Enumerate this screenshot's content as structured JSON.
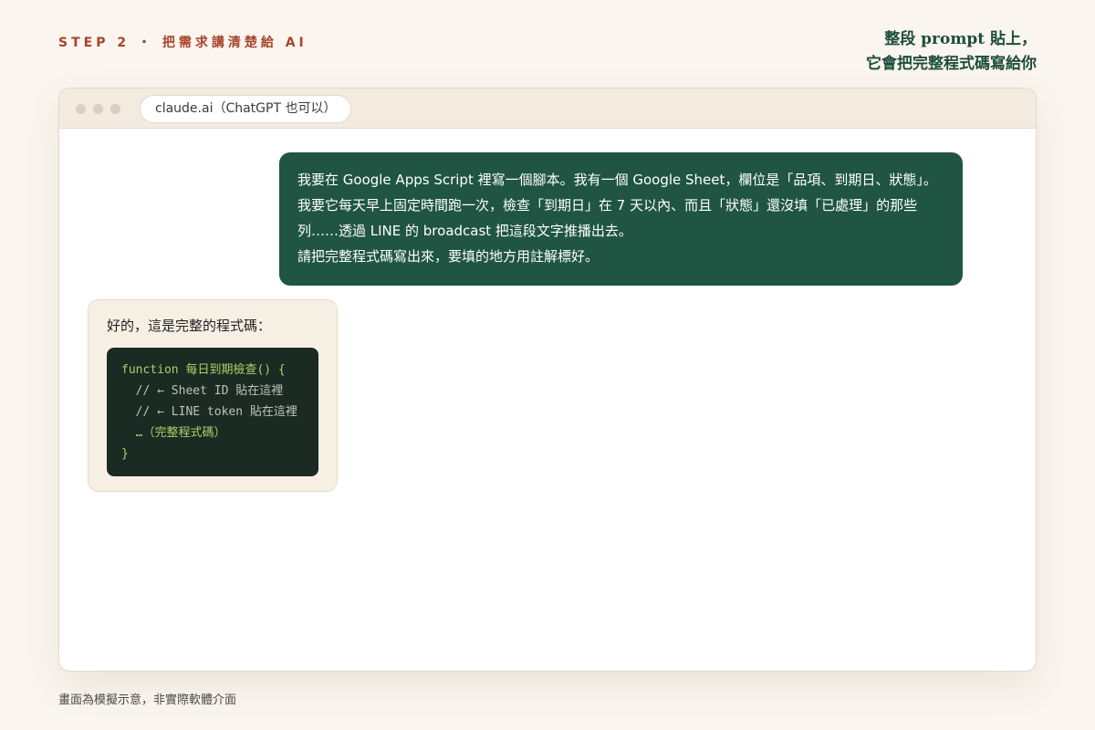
{
  "header": {
    "step_label": "STEP 2 ・ 把需求講清楚給 AI",
    "headline_line1": "整段 prompt 貼上，",
    "headline_line2": "它會把完整程式碼寫給你"
  },
  "browser": {
    "address": "claude.ai（ChatGPT 也可以）"
  },
  "chat": {
    "user_message": [
      "我要在 Google Apps Script 裡寫一個腳本。我有一個 Google Sheet，欄位是「品項、到期日、狀態」。",
      "我要它每天早上固定時間跑一次，檢查「到期日」在 7 天以內、而且「狀態」還沒填「已處理」的那些",
      "列……透過 LINE 的 broadcast 把這段文字推播出去。",
      "請把完整程式碼寫出來，要填的地方用註解標好。"
    ],
    "ai_reply": "好的，這是完整的程式碼：",
    "code_lines": [
      "function 每日到期檢查() {",
      "  // ← Sheet ID 貼在這裡",
      "  // ← LINE token 貼在這裡",
      "  …（完整程式碼）",
      "}"
    ]
  },
  "footer": {
    "note": "畫面為模擬示意，非實際軟體介面"
  },
  "colors": {
    "accent_red": "#a8432a",
    "brand_green": "#1d4d3b",
    "bubble_green": "#1f5542",
    "code_bg": "#1b2a23",
    "code_green": "#a9d36a"
  }
}
